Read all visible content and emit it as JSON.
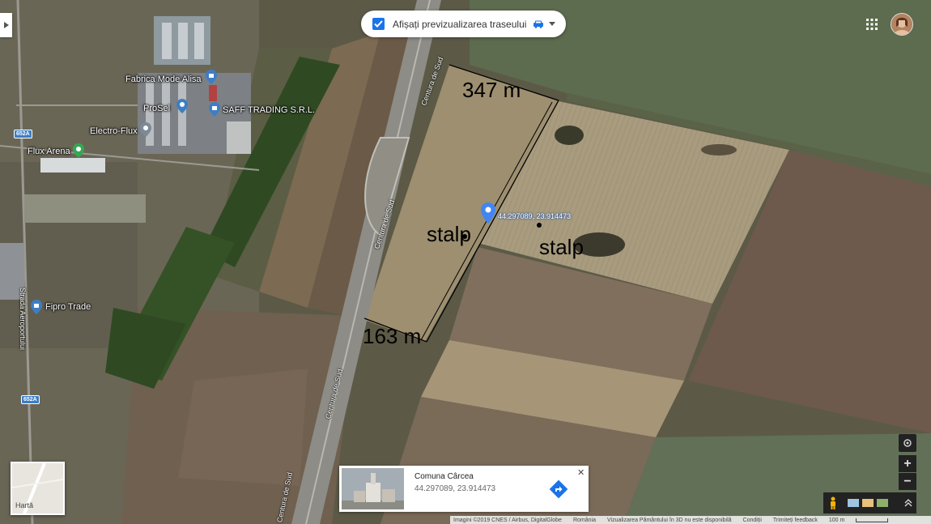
{
  "route_preview": {
    "label": "Afișați previzualizarea traseului",
    "checked": true
  },
  "pois": [
    {
      "name": "Fabrica Mode Alisa"
    },
    {
      "name": "ProSel"
    },
    {
      "name": "SAFF TRADING S.R.L."
    },
    {
      "name": "Electro-Flux"
    },
    {
      "name": "Flux Arena"
    },
    {
      "name": "Fipro Trade"
    }
  ],
  "roads": {
    "centura_1": "Centura de Sud",
    "centura_2": "Centura de Sud",
    "centura_3": "Centura de Sud",
    "centura_4": "Centura de Sud",
    "strada": "Strada Aeroportului",
    "shield_1": "652A",
    "shield_2": "652A"
  },
  "annotations": {
    "top_length": "347 m",
    "bottom_length": "163 m",
    "stalp_left": "stalp",
    "stalp_right": "stalp",
    "pin_coords": "44.297089, 23.914473"
  },
  "place_card": {
    "name": "Comuna Cârcea",
    "coords": "44.297089, 23.914473",
    "close": "✕"
  },
  "map_type": {
    "label": "Hartă"
  },
  "controls": {
    "zoom_in": "+",
    "zoom_out": "−"
  },
  "footer": {
    "imagery": "Imagini ©2019 CNES / Airbus, DigitalGlobe",
    "country": "România",
    "notice": "Vizualizarea Pământului în 3D nu este disponibilă",
    "terms": "Condiții",
    "feedback": "Trimiteți feedback",
    "scale": "100 m"
  },
  "colors": {
    "accent": "#1a73e8",
    "pin": "#4285f4"
  }
}
